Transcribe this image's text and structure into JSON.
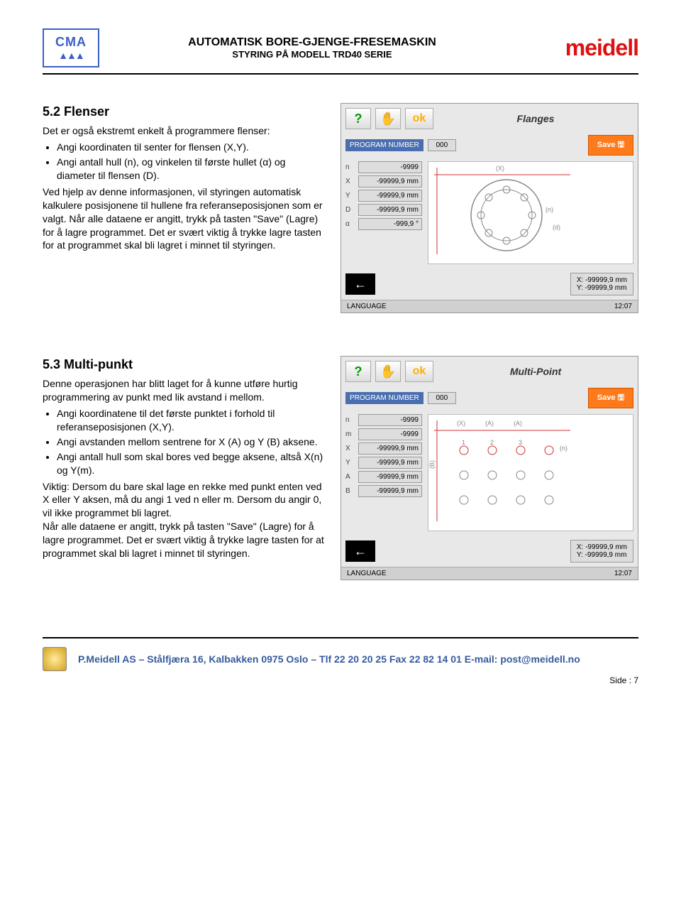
{
  "header": {
    "logo_brand": "CMA",
    "title": "AUTOMATISK BORE-GJENGE-FRESEMASKIN",
    "subtitle": "STYRING PÅ MODELL TRD40 SERIE",
    "right_brand": "meidell"
  },
  "section1": {
    "heading": "5.2 Flenser",
    "intro": "Det er også ekstremt enkelt å programmere flenser:",
    "bullets": [
      "Angi koordinaten til senter for flensen (X,Y).",
      "Angi antall hull (n), og vinkelen til første hullet (α) og diameter til flensen (D)."
    ],
    "para": "Ved hjelp av denne informasjonen, vil styringen automatisk kalkulere posisjonene til hullene fra referanseposisjonen som er valgt. Når alle dataene er angitt, trykk på tasten \"Save\" (Lagre) for å lagre programmet. Det er svært viktig å trykke lagre tasten for at programmet skal bli lagret i minnet til styringen."
  },
  "hmi1": {
    "title": "Flanges",
    "prog_label": "PROGRAM NUMBER",
    "prog_val": "000",
    "save": "Save",
    "inputs": [
      {
        "label": "n",
        "val": "-9999"
      },
      {
        "label": "X",
        "val": "-99999,9 mm"
      },
      {
        "label": "Y",
        "val": "-99999,9 mm"
      },
      {
        "label": "D",
        "val": "-99999,9 mm"
      },
      {
        "label": "α",
        "val": "-999,9 °"
      }
    ],
    "coord_x": "X: -99999,9 mm",
    "coord_y": "Y: -99999,9 mm",
    "lang": "LANGUAGE",
    "time": "12:07"
  },
  "section2": {
    "heading": "5.3 Multi-punkt",
    "intro": "Denne operasjonen har blitt laget for å kunne utføre hurtig programmering av punkt med lik avstand i mellom.",
    "bullets": [
      "Angi koordinatene til det første punktet i forhold til referanseposisjonen (X,Y).",
      "Angi avstanden mellom sentrene for X (A) og Y (B) aksene.",
      "Angi antall hull som skal bores ved begge aksene, altså X(n) og Y(m)."
    ],
    "para": "Viktig: Dersom du bare skal lage en rekke med punkt enten ved X eller Y aksen, må du angi 1 ved n eller m. Dersom du angir 0, vil ikke programmet bli lagret.\nNår alle dataene er angitt, trykk på tasten \"Save\" (Lagre) for å lagre programmet. Det er svært viktig å trykke lagre tasten for at programmet skal bli lagret i minnet til styringen."
  },
  "hmi2": {
    "title": "Multi-Point",
    "prog_label": "PROGRAM NUMBER",
    "prog_val": "000",
    "save": "Save",
    "inputs": [
      {
        "label": "n",
        "val": "-9999"
      },
      {
        "label": "m",
        "val": "-9999"
      },
      {
        "label": "X",
        "val": "-99999,9 mm"
      },
      {
        "label": "Y",
        "val": "-99999,9 mm"
      },
      {
        "label": "A",
        "val": "-99999,9 mm"
      },
      {
        "label": "B",
        "val": "-99999,9 mm"
      }
    ],
    "coord_x": "X: -99999,9 mm",
    "coord_y": "Y: -99999,9 mm",
    "lang": "LANGUAGE",
    "time": "12:07"
  },
  "footer": {
    "text": "P.Meidell AS – Stålfjæra 16, Kalbakken 0975 Oslo – Tlf 22 20 20 25  Fax 22 82 14 01  E-mail: post@meidell.no",
    "page": "Side : 7"
  },
  "icons": {
    "help": "?",
    "hand": "✋",
    "ok": "ok",
    "save_disk": "🖫",
    "arrow": "←"
  }
}
